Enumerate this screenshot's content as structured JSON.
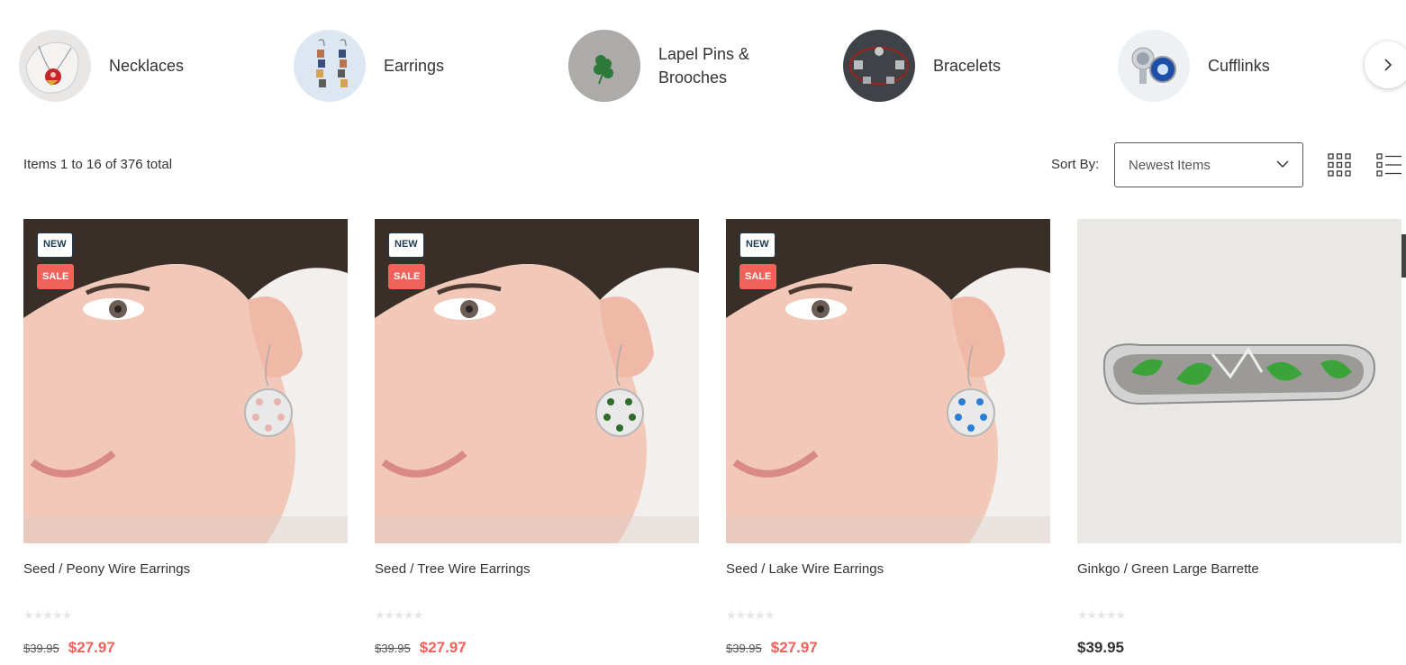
{
  "categories": [
    {
      "label": "Necklaces",
      "icon": "necklace-thumbnail"
    },
    {
      "label": "Earrings",
      "icon": "earrings-thumbnail"
    },
    {
      "label": "Lapel Pins & Brooches",
      "icon": "clover-pin-thumbnail"
    },
    {
      "label": "Bracelets",
      "icon": "bracelet-thumbnail"
    },
    {
      "label": "Cufflinks",
      "icon": "cufflinks-thumbnail"
    }
  ],
  "toolbar": {
    "items_count": "Items 1 to 16 of 376 total",
    "sort_label": "Sort By:",
    "sort_value": "Newest Items"
  },
  "products": [
    {
      "name": "Seed / Peony Wire Earrings",
      "old_price": "$39.95",
      "price": "$27.97",
      "badge_new": "NEW",
      "badge_sale": "SALE",
      "accent": "#e8b4b0",
      "stars": "★★★★★"
    },
    {
      "name": "Seed / Tree Wire Earrings",
      "old_price": "$39.95",
      "price": "$27.97",
      "badge_new": "NEW",
      "badge_sale": "SALE",
      "accent": "#2f6b2a",
      "stars": "★★★★★"
    },
    {
      "name": "Seed / Lake Wire Earrings",
      "old_price": "$39.95",
      "price": "$27.97",
      "badge_new": "NEW",
      "badge_sale": "SALE",
      "accent": "#2a7fd4",
      "stars": "★★★★★"
    },
    {
      "name": "Ginkgo / Green Large Barrette",
      "price": "$39.95",
      "accent": "#3aa33a",
      "stars": "★★★★★"
    }
  ],
  "colors": {
    "sale": "#f0625a",
    "new_badge_border": "#1d3b52",
    "text": "#333333"
  }
}
